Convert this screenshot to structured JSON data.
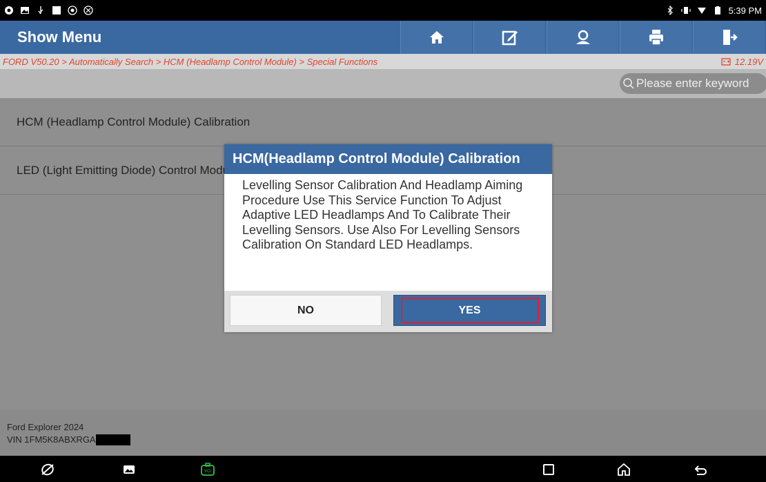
{
  "status_bar": {
    "time": "5:39 PM",
    "left_icons": [
      "chrome-icon",
      "image-icon",
      "usb-icon",
      "square-icon",
      "record-icon",
      "bluetooth-off-icon"
    ],
    "right_icons": [
      "bluetooth-icon",
      "vibrate-icon",
      "wifi-icon",
      "battery-icon"
    ]
  },
  "header": {
    "title": "Show Menu",
    "tools": [
      "home-icon",
      "edit-icon",
      "support-icon",
      "print-icon",
      "exit-icon"
    ]
  },
  "breadcrumb": {
    "path": "FORD V50.20 > Automatically Search > HCM (Headlamp Control Module) > Special Functions",
    "voltage": "12.19V"
  },
  "search": {
    "placeholder": "Please enter keyword"
  },
  "menu": {
    "items": [
      "HCM (Headlamp Control Module) Calibration",
      "LED (Light Emitting Diode) Control Module"
    ]
  },
  "vehicle": {
    "model": "Ford Explorer 2024",
    "vin": "VIN 1FM5K8ABXRGA"
  },
  "dialog": {
    "title": "HCM(Headlamp Control Module) Calibration",
    "message": "Levelling Sensor Calibration And Headlamp Aiming Procedure Use This Service Function To Adjust Adaptive LED Headlamps And To Calibrate Their Levelling Sensors. Use Also For Levelling Sensors Calibration On Standard LED Headlamps.",
    "no_label": "NO",
    "yes_label": "YES"
  },
  "colors": {
    "header": "#3a68a0",
    "breadcrumb_text": "#e0442a",
    "highlight": "#e02030"
  }
}
